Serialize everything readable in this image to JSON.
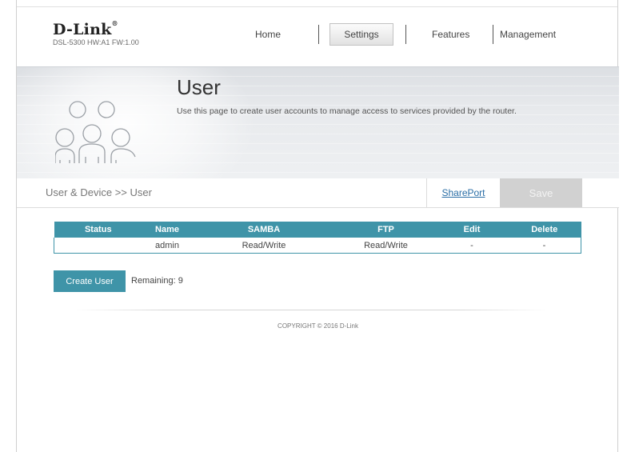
{
  "header": {
    "brand": "D-Link",
    "model_info": "DSL-5300 HW:A1 FW:1.00",
    "nav": [
      {
        "label": "Home"
      },
      {
        "label": "Settings",
        "active": true
      },
      {
        "label": "Features"
      },
      {
        "label": "Management"
      }
    ]
  },
  "banner": {
    "title": "User",
    "description": "Use this page to create user accounts to manage access to services provided by the router.",
    "icon": "users-group-icon"
  },
  "toolbar": {
    "breadcrumb": "User & Device >> User",
    "shareport_label": "SharePort",
    "save_label": "Save"
  },
  "users_table": {
    "columns": [
      "Status",
      "Name",
      "SAMBA",
      "FTP",
      "Edit",
      "Delete"
    ],
    "rows": [
      {
        "status": "",
        "name": "admin",
        "samba": "Read/Write",
        "ftp": "Read/Write",
        "edit": "-",
        "delete": "-"
      }
    ]
  },
  "actions": {
    "create_user_label": "Create User",
    "remaining_label": "Remaining: 9"
  },
  "footer": {
    "copyright": "COPYRIGHT © 2016 D-Link"
  },
  "colors": {
    "accent": "#3f94a8",
    "save_disabled": "#d1d1d1",
    "link": "#2a6ea6"
  }
}
